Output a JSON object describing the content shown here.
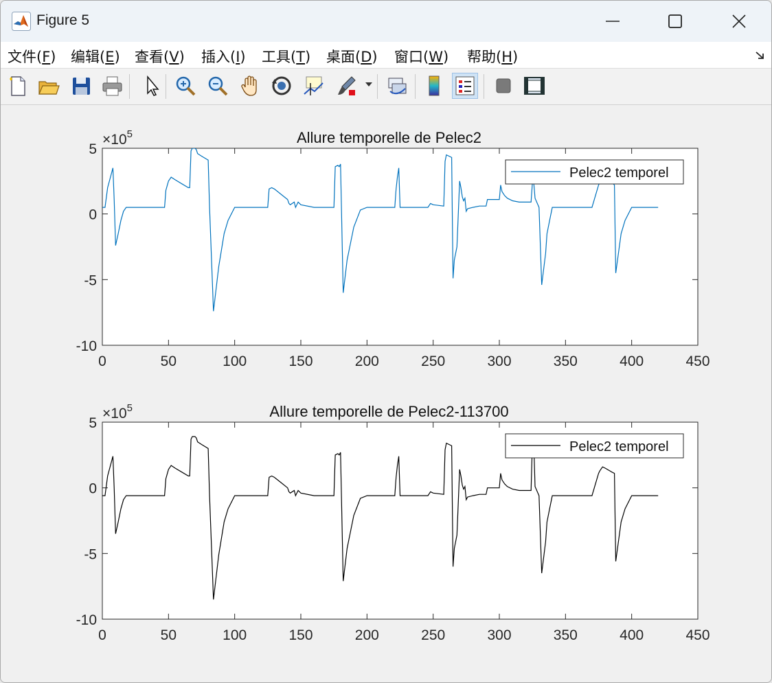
{
  "window": {
    "title": "Figure 5"
  },
  "menu": [
    {
      "pre": "文件(",
      "key": "F",
      "post": ")"
    },
    {
      "pre": "编辑(",
      "key": "E",
      "post": ")"
    },
    {
      "pre": "查看(",
      "key": "V",
      "post": ")"
    },
    {
      "pre": "插入(",
      "key": "I",
      "post": ")"
    },
    {
      "pre": "工具(",
      "key": "T",
      "post": ")"
    },
    {
      "pre": "桌面(",
      "key": "D",
      "post": ")"
    },
    {
      "pre": "窗口(",
      "key": "W",
      "post": ")"
    },
    {
      "pre": "帮助(",
      "key": "H",
      "post": ")"
    }
  ],
  "toolbar_icons": [
    "new-file-icon",
    "open-folder-icon",
    "save-icon",
    "print-icon",
    "pointer-icon",
    "zoom-in-icon",
    "zoom-out-icon",
    "pan-hand-icon",
    "rotate-3d-icon",
    "data-cursor-icon",
    "brush-icon",
    "link-plot-icon",
    "colorbar-icon",
    "legend-icon",
    "hide-plot-tools-icon",
    "show-plot-tools-icon"
  ],
  "colors": {
    "series1": "#0072bd",
    "series2": "#000000"
  },
  "chart_data": [
    {
      "type": "line",
      "title": "Allure temporelle de Pelec2",
      "multiplier": "×10",
      "exponent": "5",
      "xlim": [
        0,
        450
      ],
      "ylim": [
        -10,
        5
      ],
      "xticks": [
        "0",
        "50",
        "100",
        "150",
        "200",
        "250",
        "300",
        "350",
        "400",
        "450"
      ],
      "yticks": [
        "5",
        "0",
        "-5",
        "-10"
      ],
      "legend": "top-right",
      "series": [
        {
          "name": "Pelec2 temporel",
          "x": [
            0,
            2,
            4,
            8,
            9,
            10,
            12,
            14,
            16,
            18,
            20,
            30,
            40,
            47,
            48,
            50,
            52,
            55,
            60,
            65,
            66,
            67,
            68,
            69,
            70,
            71,
            72,
            75,
            80,
            81,
            84,
            88,
            92,
            95,
            100,
            110,
            120,
            125,
            126,
            128,
            130,
            135,
            140,
            141,
            142,
            145,
            146,
            148,
            150,
            160,
            170,
            175,
            176,
            178,
            179,
            180,
            182,
            185,
            190,
            195,
            200,
            210,
            215,
            220,
            221,
            222,
            223,
            224,
            225,
            230,
            240,
            245,
            246,
            248,
            250,
            258,
            259,
            260,
            262,
            264,
            265,
            266,
            268,
            270,
            271,
            272,
            273,
            274,
            275,
            276,
            280,
            285,
            290,
            291,
            295,
            300,
            301,
            302,
            304,
            306,
            310,
            315,
            320,
            324,
            325,
            326,
            327,
            330,
            332,
            335,
            336,
            338,
            340,
            345,
            350,
            360,
            370,
            375,
            376,
            378,
            380,
            385,
            387,
            388,
            390,
            392,
            395,
            400,
            410,
            420
          ],
          "y": [
            0.5,
            0.5,
            2,
            3.5,
            1,
            -2.4,
            -1.5,
            -0.5,
            0.2,
            0.5,
            0.5,
            0.5,
            0.5,
            0.5,
            1.8,
            2.5,
            2.8,
            2.6,
            2.3,
            2,
            2,
            4.8,
            5,
            5,
            5,
            4.9,
            4.6,
            4.4,
            4.1,
            0.5,
            -7.4,
            -4,
            -1.5,
            -0.5,
            0.5,
            0.5,
            0.5,
            0.5,
            1.9,
            2,
            1.9,
            1.5,
            1.1,
            0.8,
            0.7,
            0.9,
            0.5,
            0.9,
            0.7,
            0.5,
            0.5,
            0.5,
            3.6,
            3.7,
            3.6,
            3.8,
            -6,
            -3.5,
            -1,
            0.3,
            0.5,
            0.5,
            0.5,
            0.5,
            0.5,
            1.9,
            2.8,
            3.5,
            0.5,
            0.5,
            0.5,
            0.5,
            0.5,
            0.8,
            0.7,
            0.6,
            4,
            4.5,
            4.4,
            4.3,
            -4.9,
            -3.5,
            -2.5,
            2.5,
            2,
            1.3,
            1,
            1.2,
            0.2,
            0.4,
            0.5,
            0.6,
            0.6,
            1.1,
            1.1,
            1.1,
            2.2,
            1.7,
            1.4,
            1.2,
            1,
            0.9,
            0.9,
            0.9,
            2.4,
            2.4,
            1.2,
            0.5,
            -5.4,
            -3,
            -1.5,
            -0.5,
            0.5,
            0.5,
            0.5,
            0.5,
            0.5,
            2.2,
            2.4,
            2.4,
            2.4,
            2.4,
            2.2,
            -4.5,
            -3,
            -1.5,
            -0.5,
            0.5,
            0.5,
            0.5
          ]
        }
      ]
    },
    {
      "type": "line",
      "title": "Allure temporelle de Pelec2-113700",
      "multiplier": "×10",
      "exponent": "5",
      "xlim": [
        0,
        450
      ],
      "ylim": [
        -10,
        5
      ],
      "xticks": [
        "0",
        "50",
        "100",
        "150",
        "200",
        "250",
        "300",
        "350",
        "400",
        "450"
      ],
      "yticks": [
        "5",
        "0",
        "-5",
        "-10"
      ],
      "legend": "top-right",
      "series": [
        {
          "name": "Pelec2 temporel",
          "x": [
            0,
            2,
            4,
            8,
            9,
            10,
            12,
            14,
            16,
            18,
            20,
            30,
            40,
            47,
            48,
            50,
            52,
            55,
            60,
            65,
            66,
            67,
            68,
            69,
            70,
            71,
            72,
            75,
            80,
            81,
            84,
            88,
            92,
            95,
            100,
            110,
            120,
            125,
            126,
            128,
            130,
            135,
            140,
            141,
            142,
            145,
            146,
            148,
            150,
            160,
            170,
            175,
            176,
            178,
            179,
            180,
            182,
            185,
            190,
            195,
            200,
            210,
            215,
            220,
            221,
            222,
            223,
            224,
            225,
            230,
            240,
            245,
            246,
            248,
            250,
            258,
            259,
            260,
            262,
            264,
            265,
            266,
            268,
            270,
            271,
            272,
            273,
            274,
            275,
            276,
            280,
            285,
            290,
            291,
            295,
            300,
            301,
            302,
            304,
            306,
            310,
            315,
            320,
            324,
            325,
            326,
            327,
            330,
            332,
            335,
            336,
            338,
            340,
            345,
            350,
            360,
            370,
            375,
            376,
            378,
            380,
            385,
            387,
            388,
            390,
            392,
            395,
            400,
            410,
            420
          ],
          "y": [
            -0.6,
            -0.6,
            0.9,
            2.4,
            -0.1,
            -3.5,
            -2.6,
            -1.6,
            -0.9,
            -0.6,
            -0.6,
            -0.6,
            -0.6,
            -0.6,
            0.7,
            1.4,
            1.7,
            1.5,
            1.2,
            0.9,
            0.9,
            3.7,
            3.9,
            3.9,
            3.9,
            3.8,
            3.5,
            3.3,
            3,
            -0.6,
            -8.5,
            -5.1,
            -2.6,
            -1.6,
            -0.6,
            -0.6,
            -0.6,
            -0.6,
            0.8,
            0.9,
            0.8,
            0.4,
            0,
            -0.3,
            -0.4,
            -0.2,
            -0.6,
            -0.2,
            -0.4,
            -0.6,
            -0.6,
            -0.6,
            2.5,
            2.6,
            2.5,
            2.7,
            -7.1,
            -4.6,
            -2.1,
            -0.8,
            -0.6,
            -0.6,
            -0.6,
            -0.6,
            -0.6,
            0.8,
            1.7,
            2.4,
            -0.6,
            -0.6,
            -0.6,
            -0.6,
            -0.6,
            -0.3,
            -0.4,
            -0.5,
            2.9,
            3.4,
            3.3,
            3.2,
            -6,
            -4.6,
            -3.6,
            1.4,
            0.9,
            0.2,
            -0.1,
            0.1,
            -0.9,
            -0.7,
            -0.6,
            -0.5,
            -0.5,
            0,
            0,
            0,
            1.1,
            0.6,
            0.3,
            0.1,
            -0.1,
            -0.2,
            -0.2,
            -0.2,
            3.5,
            3.5,
            0.1,
            -0.6,
            -6.5,
            -4.1,
            -2.6,
            -1.6,
            -0.6,
            -0.6,
            -0.6,
            -0.6,
            -0.6,
            1.1,
            1.3,
            1.6,
            1.5,
            1.2,
            1.1,
            -5.6,
            -4.1,
            -2.6,
            -1.6,
            -0.6,
            -0.6,
            -0.6
          ]
        }
      ]
    }
  ]
}
